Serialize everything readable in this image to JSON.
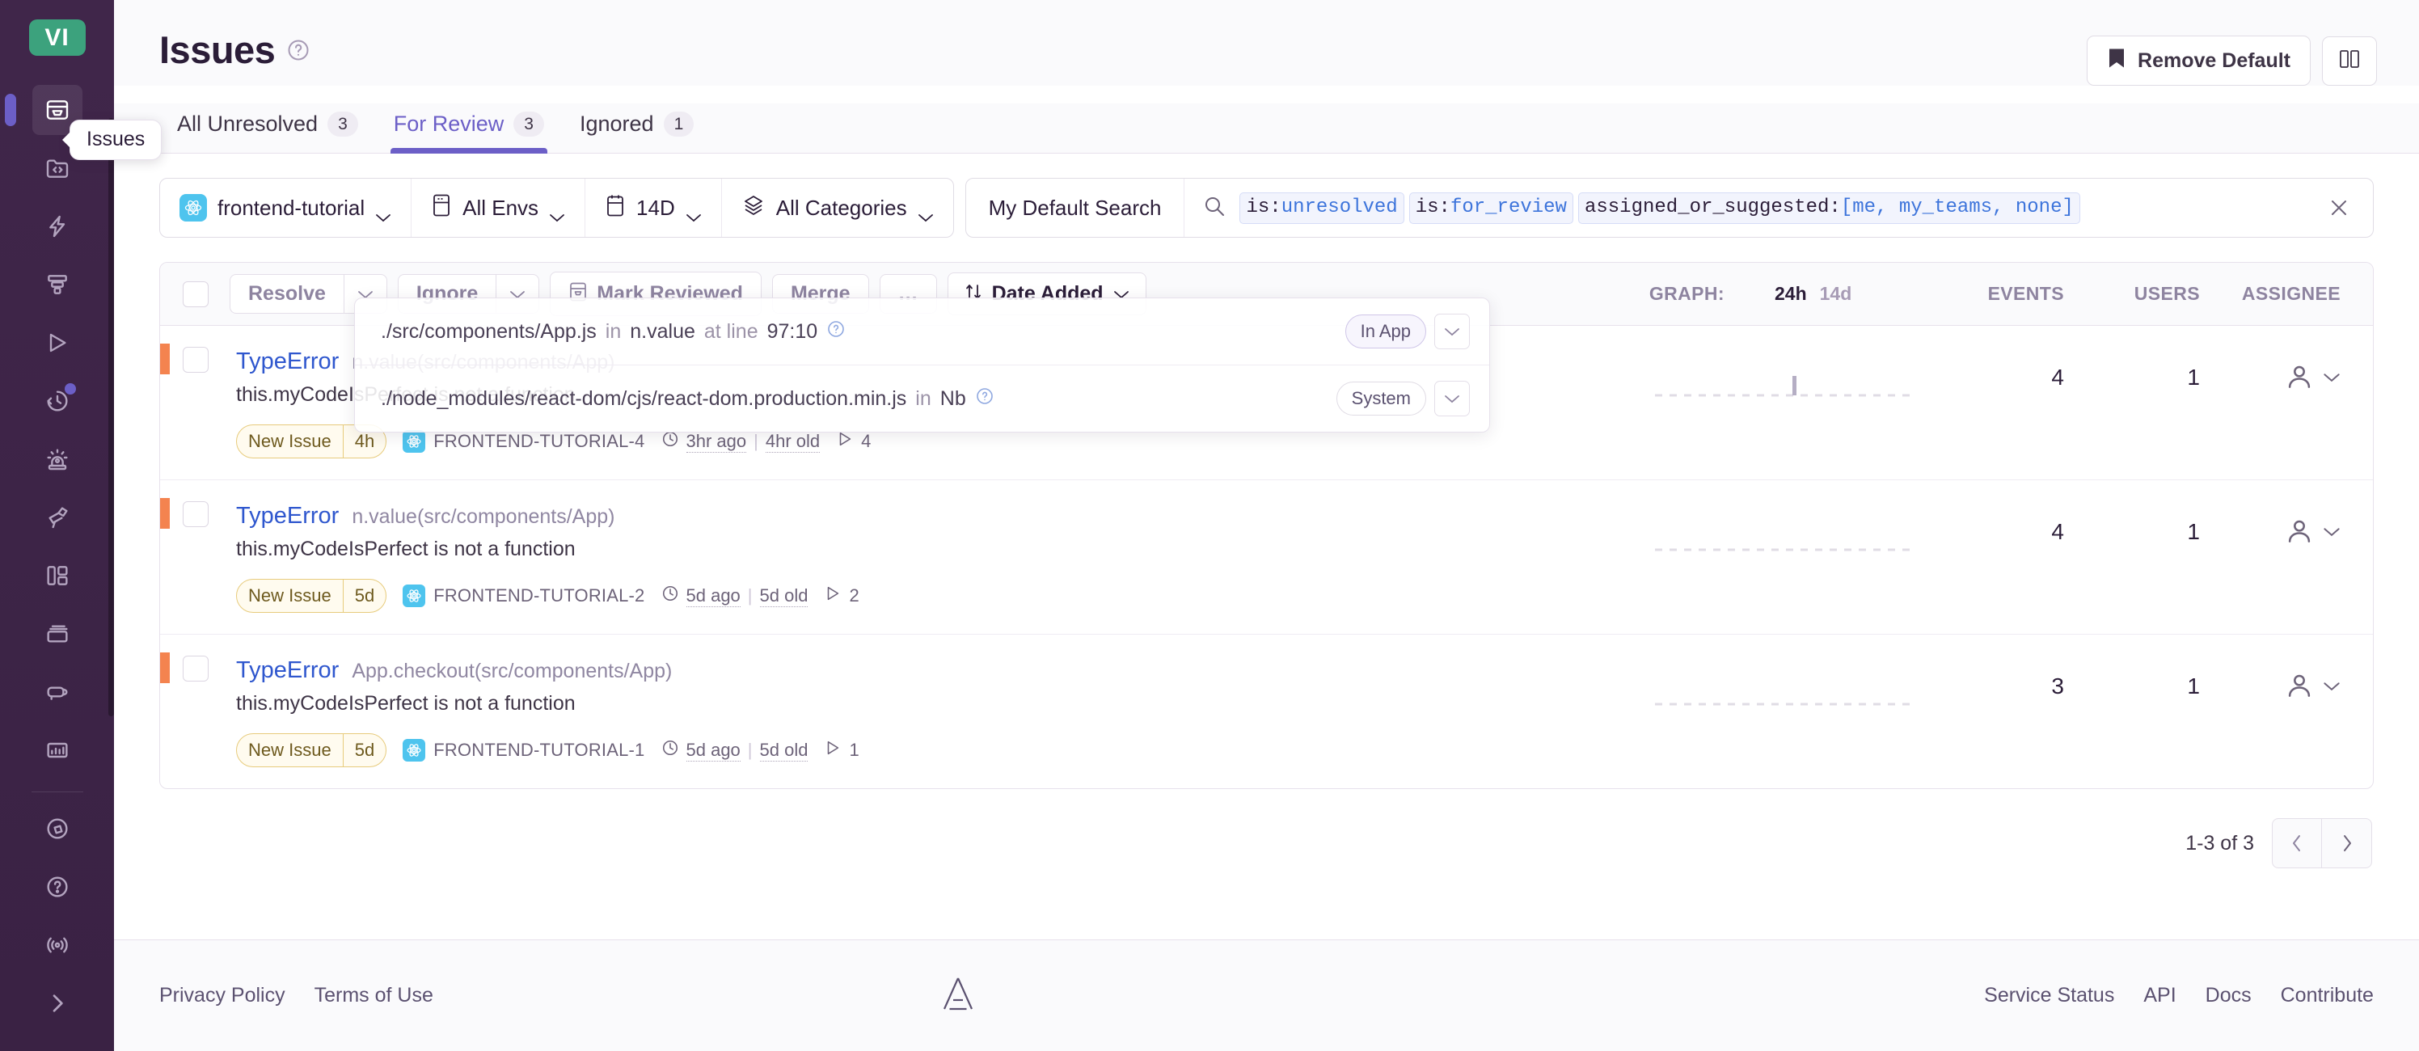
{
  "sidebar": {
    "org_initials": "VI",
    "tooltip": "Issues",
    "items": [
      {
        "name": "issues",
        "icon": "issues-archive-icon",
        "active": true,
        "badge": false
      },
      {
        "name": "projects",
        "icon": "projects-code-folder-icon",
        "active": false,
        "badge": false
      },
      {
        "name": "performance",
        "icon": "performance-lightning-icon",
        "active": false,
        "badge": false
      },
      {
        "name": "insights",
        "icon": "insights-funnel-icon",
        "active": false,
        "badge": false
      },
      {
        "name": "replays",
        "icon": "replays-play-icon",
        "active": false,
        "badge": false
      },
      {
        "name": "crons",
        "icon": "crons-clock-history-icon",
        "active": false,
        "badge": true
      },
      {
        "name": "alerts",
        "icon": "alerts-siren-icon",
        "active": false,
        "badge": false
      },
      {
        "name": "discover",
        "icon": "discover-telescope-icon",
        "active": false,
        "badge": false
      },
      {
        "name": "dashboards",
        "icon": "dashboards-grid-icon",
        "active": false,
        "badge": false
      },
      {
        "name": "releases",
        "icon": "releases-stack-icon",
        "active": false,
        "badge": false
      },
      {
        "name": "user-feedback",
        "icon": "user-feedback-megaphone-icon",
        "active": false,
        "badge": false
      },
      {
        "name": "stats",
        "icon": "stats-bar-chart-icon",
        "active": false,
        "badge": false
      }
    ],
    "bottom_items": [
      {
        "name": "whats-new",
        "icon": "whats-new-broadcast-icon"
      },
      {
        "name": "help",
        "icon": "help-question-icon"
      },
      {
        "name": "service-incidents",
        "icon": "service-incidents-signal-icon"
      },
      {
        "name": "expand-sidebar",
        "icon": "chevron-right-icon"
      }
    ]
  },
  "header": {
    "title": "Issues",
    "help_icon": "question-circle-icon",
    "remove_default_label": "Remove Default",
    "remove_default_icon": "bookmark-icon",
    "layout_toggle_icon": "panel-columns-icon"
  },
  "tabs": [
    {
      "label": "All Unresolved",
      "count": "3",
      "active": false
    },
    {
      "label": "For Review",
      "count": "3",
      "active": true
    },
    {
      "label": "Ignored",
      "count": "1",
      "active": false
    }
  ],
  "filters": {
    "project": "frontend-tutorial",
    "project_icon": "react-logo-icon",
    "environment": "All Envs",
    "environment_icon": "server-icon",
    "date_range": "14D",
    "date_icon": "calendar-icon",
    "categories": "All Categories",
    "categories_icon": "layers-icon",
    "saved_search": "My Default Search",
    "search_icon": "search-icon",
    "clear_icon": "close-icon",
    "query_tokens": [
      {
        "key": "is:",
        "value": "unresolved"
      },
      {
        "key": "is:",
        "value": "for_review"
      },
      {
        "key": "assigned_or_suggested:",
        "value": "[me, my_teams, none]"
      }
    ]
  },
  "toolbar": {
    "resolve_label": "Resolve",
    "ignore_label": "Ignore",
    "mark_reviewed_label": "Mark Reviewed",
    "mark_reviewed_icon": "archive-icon",
    "merge_label": "Merge",
    "more_label": "…",
    "sort_label": "Date Added",
    "sort_icon": "sort-arrows-icon",
    "graph_label": "GRAPH:",
    "graph_24h": "24h",
    "graph_14d": "14d",
    "events_label": "EVENTS",
    "users_label": "USERS",
    "assignee_label": "ASSIGNEE"
  },
  "stack_popup": {
    "lines": [
      {
        "file": "./src/components/App.js",
        "in_word": "in",
        "fn": "n.value",
        "at_word": "at line",
        "line_no": "97:10",
        "help_icon": "question-circle-icon",
        "pill": "In App",
        "pill_style": "inapp"
      },
      {
        "file": "./node_modules/react-dom/cjs/react-dom.production.min.js",
        "in_word": "in",
        "fn": "Nb",
        "at_word": "",
        "line_no": "",
        "help_icon": "question-circle-icon",
        "pill": "System",
        "pill_style": "system"
      }
    ]
  },
  "issues": [
    {
      "type": "TypeError",
      "culprit": "n.value(src/components/App)",
      "message": "this.myCodeIsPerfect is not a function",
      "tag_label": "New Issue",
      "tag_age": "4h",
      "short_id": "FRONTEND-TUTORIAL-4",
      "last_seen": "3hr ago",
      "first_seen": "4hr old",
      "replays": "4",
      "events": "4",
      "users": "1",
      "level_color": "#F4834F"
    },
    {
      "type": "TypeError",
      "culprit": "n.value(src/components/App)",
      "message": "this.myCodeIsPerfect is not a function",
      "tag_label": "New Issue",
      "tag_age": "5d",
      "short_id": "FRONTEND-TUTORIAL-2",
      "last_seen": "5d ago",
      "first_seen": "5d old",
      "replays": "2",
      "events": "4",
      "users": "1",
      "level_color": "#F4834F"
    },
    {
      "type": "TypeError",
      "culprit": "App.checkout(src/components/App)",
      "message": "this.myCodeIsPerfect is not a function",
      "tag_label": "New Issue",
      "tag_age": "5d",
      "short_id": "FRONTEND-TUTORIAL-1",
      "last_seen": "5d ago",
      "first_seen": "5d old",
      "replays": "1",
      "events": "3",
      "users": "1",
      "level_color": "#F4834F"
    }
  ],
  "pagination": {
    "label": "1-3 of 3",
    "prev_icon": "chevron-left-icon",
    "next_icon": "chevron-right-icon"
  },
  "footer": {
    "left_links": [
      "Privacy Policy",
      "Terms of Use"
    ],
    "logo_icon": "sentry-logo-icon",
    "right_links": [
      "Service Status",
      "API",
      "Docs",
      "Contribute"
    ]
  },
  "colors": {
    "accent": "#6C5FC7",
    "sidebar_bg": "#3E2648",
    "org_avatar_bg": "#3CA27D",
    "level_orange": "#F4834F",
    "link_blue": "#2F57CE",
    "project_badge": "#4EC4EE"
  }
}
